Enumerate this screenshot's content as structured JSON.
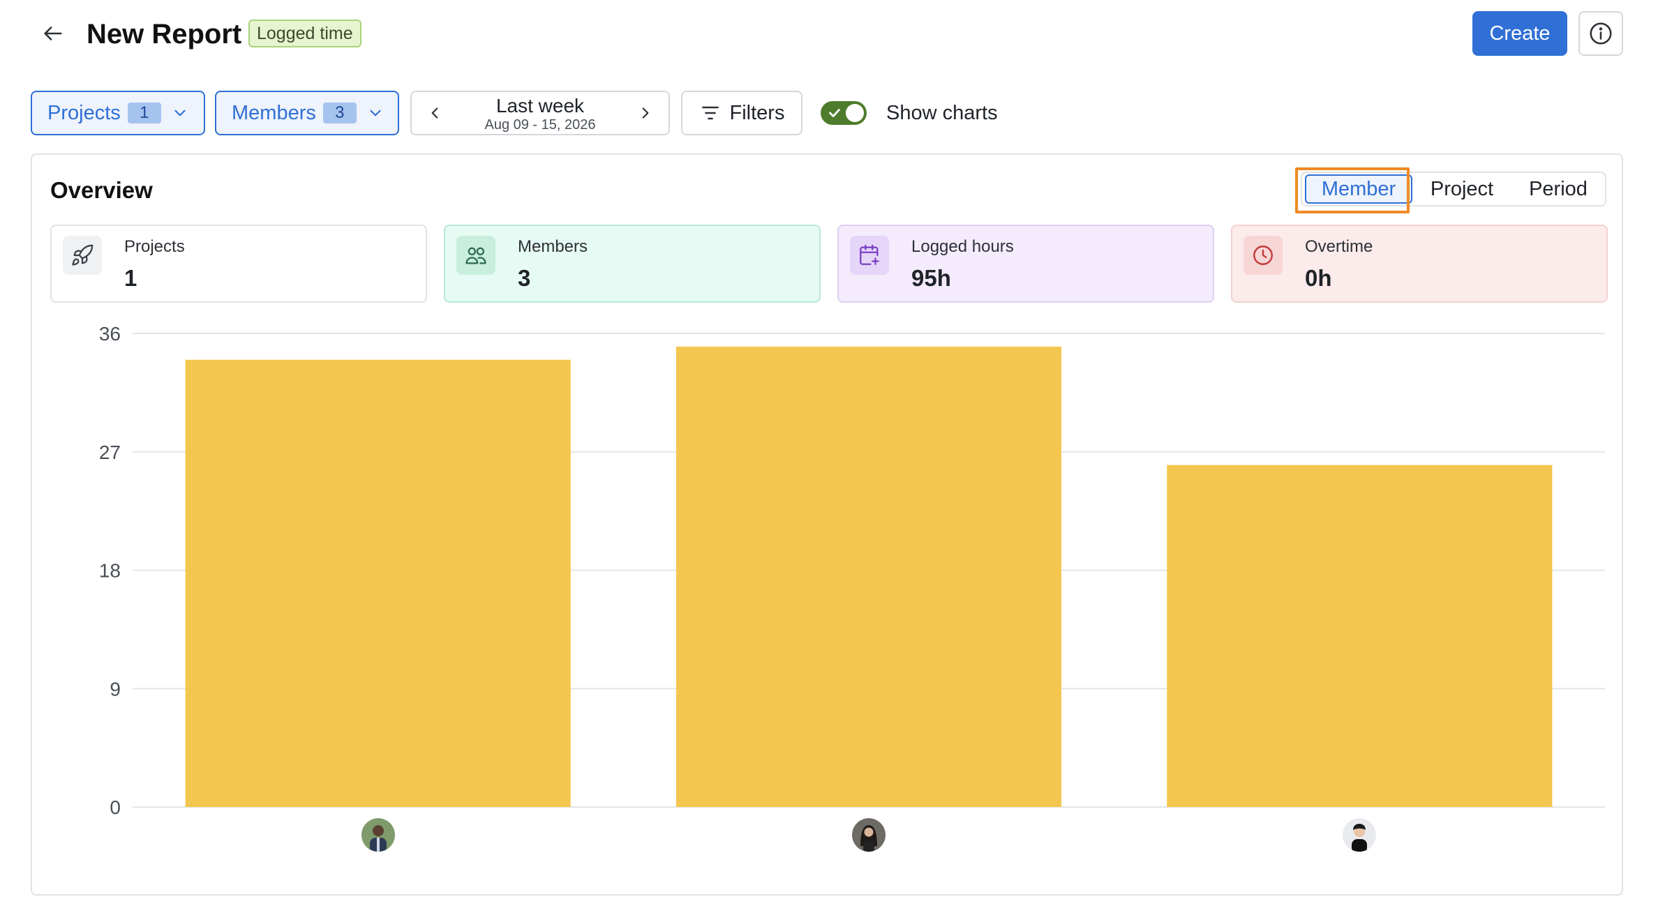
{
  "header": {
    "title": "New Report",
    "badge": "Logged time",
    "create_label": "Create"
  },
  "toolbar": {
    "projects": {
      "label": "Projects",
      "count": "1"
    },
    "members": {
      "label": "Members",
      "count": "3"
    },
    "period": {
      "label": "Last week",
      "range": "Aug 09 - 15, 2026"
    },
    "filters_label": "Filters",
    "show_charts": {
      "label": "Show charts",
      "enabled": true
    }
  },
  "overview": {
    "title": "Overview",
    "group_by": {
      "options": [
        "Member",
        "Project",
        "Period"
      ],
      "selected": "Member"
    },
    "cards": [
      {
        "label": "Projects",
        "value": "1",
        "icon": "rocket-icon",
        "bg": "#ffffff",
        "border": "#dfe2e6",
        "icon_bg": "#f0f1f3",
        "icon_color": "#3a3f46"
      },
      {
        "label": "Members",
        "value": "3",
        "icon": "users-icon",
        "bg": "#e6fbf3",
        "border": "#b9e8d3",
        "icon_bg": "#c9eedd",
        "icon_color": "#2d6b52"
      },
      {
        "label": "Logged hours",
        "value": "95h",
        "icon": "calendar-plus-icon",
        "bg": "#f4ecfd",
        "border": "#ddd0f2",
        "icon_bg": "#e5d5f8",
        "icon_color": "#7a3fc2"
      },
      {
        "label": "Overtime",
        "value": "0h",
        "icon": "clock-icon",
        "bg": "#fcebeb",
        "border": "#f2d1d1",
        "icon_bg": "#f7d6d6",
        "icon_color": "#c23a3a"
      }
    ]
  },
  "chart_data": {
    "type": "bar",
    "categories": [
      "member-1",
      "member-2",
      "member-3"
    ],
    "values": [
      34.0,
      35.0,
      26.0
    ],
    "yticks": [
      "0",
      "9",
      "18",
      "27",
      "36"
    ],
    "ylim": [
      0,
      36
    ],
    "grid": true,
    "bar_color": "#f3c74f"
  }
}
